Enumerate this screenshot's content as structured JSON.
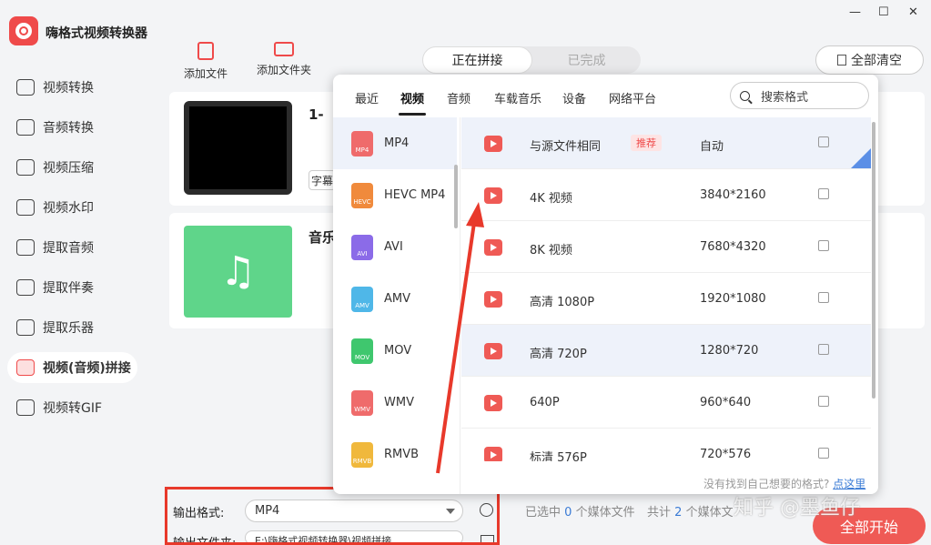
{
  "app": {
    "title": "嗨格式视频转换器"
  },
  "window": {
    "minimize": "—",
    "maximize": "☐",
    "close": "✕"
  },
  "sidebar": {
    "items": [
      {
        "label": "视频转换",
        "icon": "video-convert-icon"
      },
      {
        "label": "音频转换",
        "icon": "audio-convert-icon"
      },
      {
        "label": "视频压缩",
        "icon": "video-compress-icon"
      },
      {
        "label": "视频水印",
        "icon": "watermark-icon"
      },
      {
        "label": "提取音频",
        "icon": "extract-audio-icon"
      },
      {
        "label": "提取伴奏",
        "icon": "extract-accompaniment-icon"
      },
      {
        "label": "提取乐器",
        "icon": "guitar-icon"
      },
      {
        "label": "视频(音频)拼接",
        "icon": "merge-icon",
        "active": true
      },
      {
        "label": "视频转GIF",
        "icon": "gif-icon"
      }
    ]
  },
  "toolbar": {
    "add_file": "添加文件",
    "add_folder": "添加文件夹",
    "clear_all": "全部清空"
  },
  "status_tabs": {
    "active": "正在拼接",
    "inactive": "已完成"
  },
  "cards": [
    {
      "name": "1-",
      "tag": "字幕"
    },
    {
      "name": "音乐"
    }
  ],
  "popup": {
    "tabs": [
      "最近",
      "视频",
      "音频",
      "车载音乐",
      "设备",
      "网络平台"
    ],
    "active_tab": "视频",
    "search_placeholder": "搜索格式",
    "formats": [
      {
        "name": "MP4",
        "color": "#ef6b6b"
      },
      {
        "name": "HEVC MP4",
        "color": "#f08a3c"
      },
      {
        "name": "AVI",
        "color": "#8b6be8"
      },
      {
        "name": "AMV",
        "color": "#4fb7e8"
      },
      {
        "name": "MOV",
        "color": "#3fc76e"
      },
      {
        "name": "WMV",
        "color": "#ef6b6b"
      },
      {
        "name": "RMVB",
        "color": "#f0b83c"
      }
    ],
    "options": [
      {
        "name": "与源文件相同",
        "badge": "推荐",
        "res": "自动"
      },
      {
        "name": "4K 视频",
        "res": "3840*2160"
      },
      {
        "name": "8K 视频",
        "res": "7680*4320"
      },
      {
        "name": "高清 1080P",
        "res": "1920*1080"
      },
      {
        "name": "高清 720P",
        "res": "1280*720"
      },
      {
        "name": "640P",
        "res": "960*640"
      },
      {
        "name": "标清 576P",
        "res": "720*576"
      }
    ],
    "footer_text": "没有找到自己想要的格式?",
    "footer_link": "点这里"
  },
  "bottom": {
    "output_format_label": "输出格式:",
    "output_format_value": "MP4",
    "output_folder_label": "输出文件夹:",
    "output_folder_value": "E:\\嗨格式视频转换器\\视频拼接",
    "selected_prefix": "已选中",
    "selected_count": "0",
    "selected_suffix": "个媒体文件",
    "total_prefix": "共计",
    "total_count": "2",
    "total_suffix": "个媒体文",
    "start_button": "全部开始"
  },
  "watermark": "知乎 @墨鱼仔",
  "colors": {
    "accent": "#ef4a4a",
    "annotation": "#e8392b",
    "link": "#3a7bd5"
  }
}
